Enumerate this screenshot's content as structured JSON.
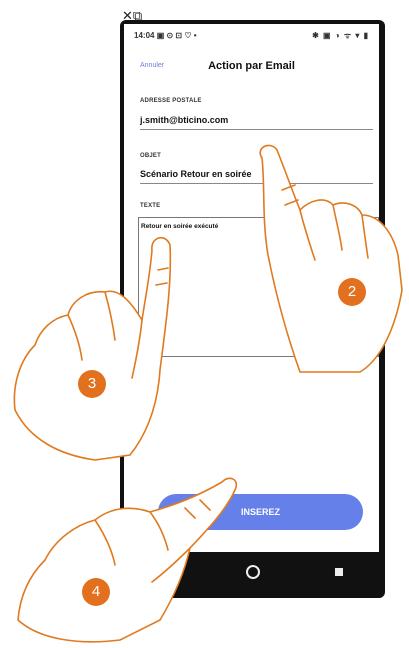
{
  "status_bar": {
    "time": "14:04",
    "left_icons": "▣ ⊙ ⊡ ♡ •",
    "right_icons": "✱ ▣ ◑ ᯤ ▾ ▮"
  },
  "header": {
    "cancel_label": "Annuler",
    "title": "Action par Email"
  },
  "form": {
    "address": {
      "label": "ADRESSE POSTALE",
      "value": "j.smith@bticino.com"
    },
    "subject": {
      "label": "OBJET",
      "value": "Scénario Retour en soirée"
    },
    "text": {
      "label": "TEXTE",
      "value": "Retour en soirée exécuté"
    }
  },
  "insert_label": "INSEREZ",
  "steps": [
    "2",
    "3",
    "4"
  ],
  "colors": {
    "accent": "#6680ea",
    "badge": "#e2701e",
    "hand": "#e07a1f"
  }
}
